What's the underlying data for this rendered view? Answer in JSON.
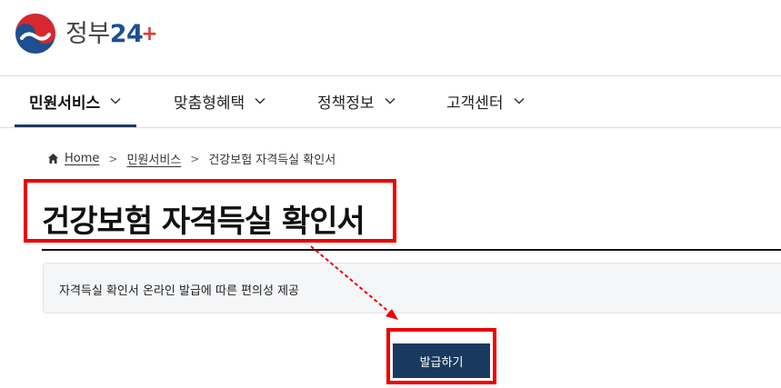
{
  "logo": {
    "text": "정부",
    "number": "24",
    "plus": "+"
  },
  "nav": {
    "items": [
      {
        "label": "민원서비스"
      },
      {
        "label": "맞춤형혜택"
      },
      {
        "label": "정책정보"
      },
      {
        "label": "고객센터"
      }
    ]
  },
  "breadcrumb": {
    "home": "Home",
    "level1": "민원서비스",
    "current": "건강보험 자격득실 확인서"
  },
  "page": {
    "title": "건강보험 자격득실 확인서",
    "description": "자격득실 확인서 온라인 발급에 따른 편의성 제공"
  },
  "actions": {
    "issue_label": "발급하기"
  },
  "colors": {
    "accent": "#183a5e",
    "highlight": "#ee0000",
    "logo_blue": "#1d4f91",
    "logo_red": "#e03a3a"
  }
}
